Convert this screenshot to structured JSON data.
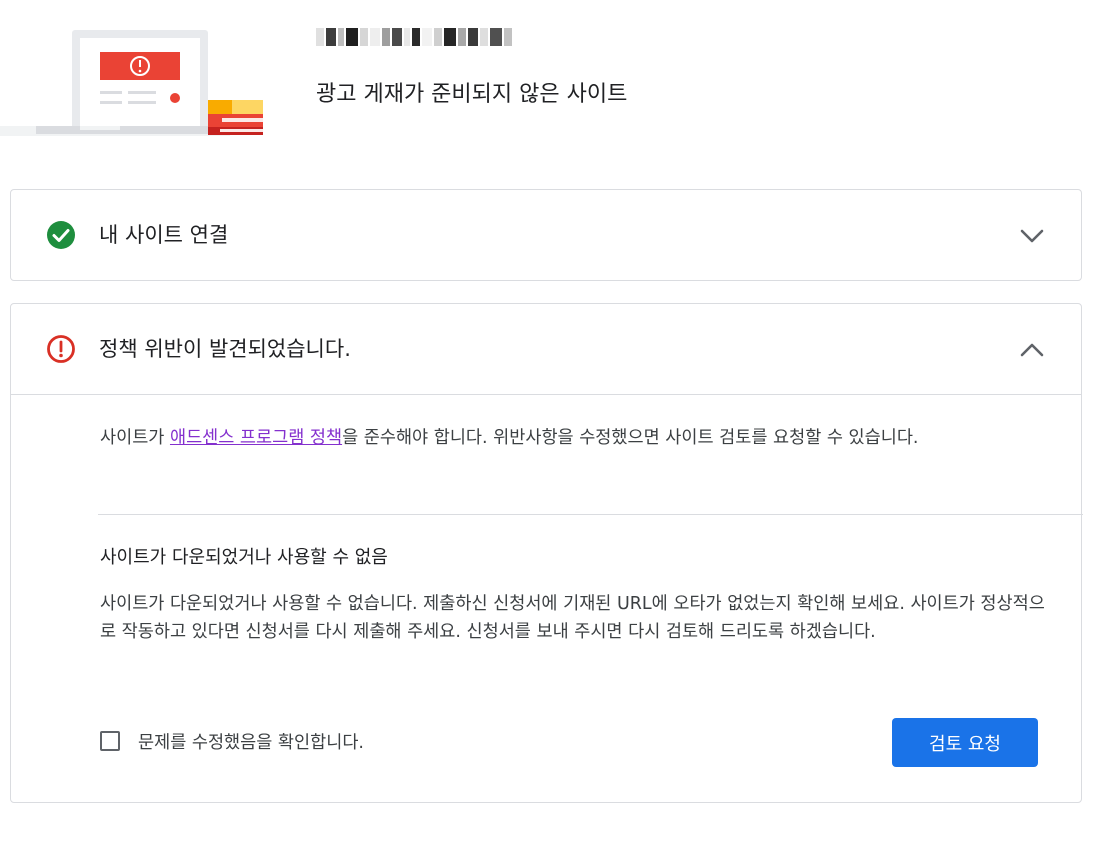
{
  "header": {
    "page_title": "광고 게재가 준비되지 않은 사이트"
  },
  "connect_card": {
    "title": "내 사이트 연결",
    "status": "complete",
    "status_color": "#1e8e3e",
    "status_icon": "check-circle-icon",
    "toggle_icon": "chevron-down-icon",
    "expanded": false
  },
  "policy_card": {
    "title": "정책 위반이 발견되었습니다.",
    "status": "error",
    "status_color": "#d93025",
    "status_icon": "error-circle-icon",
    "toggle_icon": "chevron-up-icon",
    "expanded": true,
    "intro": {
      "prefix": "사이트가 ",
      "link_text": "애드센스 프로그램 정책",
      "suffix": "을 준수해야 합니다. 위반사항을 수정했으면 사이트 검토를 요청할 수 있습니다."
    },
    "issue_title": "사이트가 다운되었거나 사용할 수 없음",
    "issue_description": "사이트가 다운되었거나 사용할 수 없습니다. 제출하신 신청서에 기재된 URL에 오타가 없었는지 확인해 보세요. 사이트가 정상적으로 작동하고 있다면 신청서를 다시 제출해 주세요. 신청서를 보내 주시면 다시 검토해 드리도록 하겠습니다.",
    "confirm_label": "문제를 수정했음을 확인합니다.",
    "confirm_checked": false,
    "review_button_label": "검토 요청"
  },
  "colors": {
    "primary_button": "#1a73e8",
    "link": "#8430ce",
    "border": "#dadce0"
  }
}
